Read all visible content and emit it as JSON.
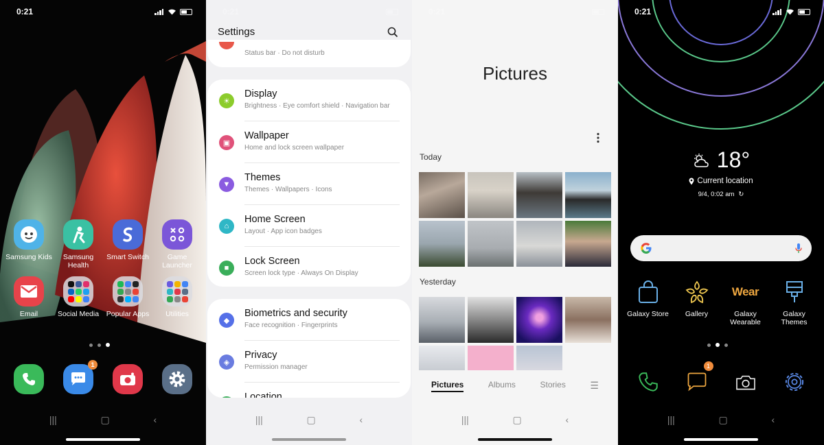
{
  "status_time": "0:21",
  "home": {
    "apps_row1": [
      {
        "label": "Samsung Kids",
        "icon": "kids-icon",
        "color": "#4fb3e8"
      },
      {
        "label": "Samsung Health",
        "icon": "health-icon",
        "color": "#3ac1a3"
      },
      {
        "label": "Smart Switch",
        "icon": "smart-switch-icon",
        "color": "#4a6bd8"
      },
      {
        "label": "Game Launcher",
        "icon": "game-launcher-icon",
        "color": "#7b56d8"
      }
    ],
    "apps_row2": [
      {
        "label": "Email",
        "icon": "email-icon",
        "color": "#e8434a"
      },
      {
        "label": "Social Media",
        "icon": "folder-icon",
        "color": "#ddd"
      },
      {
        "label": "Popular Apps",
        "icon": "folder-icon",
        "color": "#ddd"
      },
      {
        "label": "Utilities",
        "icon": "folder-icon",
        "color": "#ddd"
      }
    ],
    "dock": [
      {
        "name": "phone-icon",
        "color": "#3aba5a"
      },
      {
        "name": "messages-icon",
        "color": "#3a8ae8",
        "badge": "1"
      },
      {
        "name": "camera-icon",
        "color": "#e0384a"
      },
      {
        "name": "settings-icon",
        "color": "#5a6f88"
      }
    ]
  },
  "settings": {
    "title": "Settings",
    "partial_sub": "Status bar · Do not disturb",
    "group1": [
      {
        "title": "Display",
        "sub": "Brightness · Eye comfort shield · Navigation bar",
        "color": "#8ccc2c",
        "icon": "sun-icon"
      },
      {
        "title": "Wallpaper",
        "sub": "Home and lock screen wallpaper",
        "color": "#e0527a",
        "icon": "wallpaper-icon"
      },
      {
        "title": "Themes",
        "sub": "Themes · Wallpapers · Icons",
        "color": "#8a5be0",
        "icon": "themes-icon"
      },
      {
        "title": "Home Screen",
        "sub": "Layout · App icon badges",
        "color": "#2fb7c6",
        "icon": "home-icon"
      },
      {
        "title": "Lock Screen",
        "sub": "Screen lock type · Always On Display",
        "color": "#3aae5a",
        "icon": "lock-icon"
      }
    ],
    "group2": [
      {
        "title": "Biometrics and security",
        "sub": "Face recognition · Fingerprints",
        "color": "#5570e8",
        "icon": "shield-icon"
      },
      {
        "title": "Privacy",
        "sub": "Permission manager",
        "color": "#6a7ce0",
        "icon": "privacy-icon"
      },
      {
        "title": "Location",
        "sub": "",
        "color": "#3aae5a",
        "icon": "location-icon"
      }
    ]
  },
  "gallery": {
    "title": "Pictures",
    "section_today": "Today",
    "section_yesterday": "Yesterday",
    "tabs": [
      "Pictures",
      "Albums",
      "Stories"
    ]
  },
  "themed": {
    "temp": "18°",
    "location": "Current location",
    "date": "9/4, 0:02 am",
    "apps": [
      {
        "label": "Galaxy Store",
        "icon": "bag-icon",
        "color": "#6ab0e8"
      },
      {
        "label": "Gallery",
        "icon": "flower-icon",
        "color": "#f0c850"
      },
      {
        "label": "Galaxy Wearable",
        "icon": "wear-icon",
        "color": "#f0a840",
        "text": "Wear"
      },
      {
        "label": "Galaxy Themes",
        "icon": "brush-icon",
        "color": "#6ab0e8"
      }
    ],
    "dock_badge": "1"
  }
}
